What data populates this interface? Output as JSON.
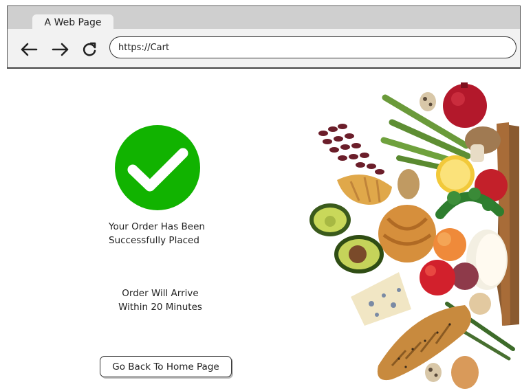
{
  "browser": {
    "tab_title": "A Web Page",
    "url": "https://Cart",
    "nav": {
      "back_icon": "arrow-left-icon",
      "forward_icon": "arrow-right-icon",
      "reload_icon": "reload-icon"
    }
  },
  "confirmation": {
    "icon": "check-circle-icon",
    "icon_color": "#11b300",
    "message_line1": "Your Order Has Been",
    "message_line2": "Successfully Placed",
    "arrival_line1": "Order Will Arrive",
    "arrival_line2": "Within 20 Minutes",
    "home_button_label": "Go Back To Home Page"
  },
  "hero_image": {
    "subject": "groceries-spilling-from-paper-bag"
  }
}
